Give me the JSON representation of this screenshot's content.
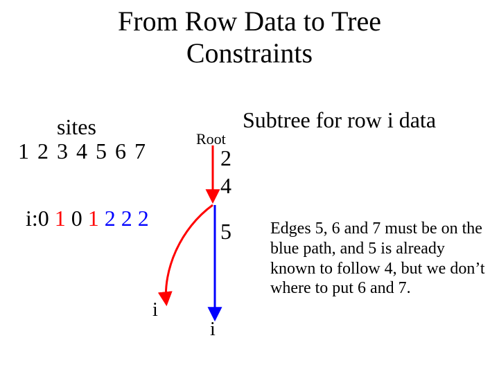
{
  "title_line1": "From Row Data to Tree",
  "title_line2": "Constraints",
  "subtree_title": "Subtree for row i data",
  "sites_label": "sites",
  "sites_numbers": "1 2 3 4 5 6 7",
  "row_i_prefix": "i:",
  "row_i_values": [
    {
      "v": "0",
      "color": "c-black"
    },
    {
      "v": "1",
      "color": "c-red"
    },
    {
      "v": "0",
      "color": "c-black"
    },
    {
      "v": "1",
      "color": "c-red"
    },
    {
      "v": "2",
      "color": "c-blue"
    },
    {
      "v": "2",
      "color": "c-blue"
    },
    {
      "v": "2",
      "color": "c-blue"
    }
  ],
  "root_label": "Root",
  "node_2": "2",
  "node_4": "4",
  "node_5": "5",
  "leaf_i_left": "i",
  "leaf_i_bottom": "i",
  "edge_note": "Edges 5, 6 and 7 must be on the blue path, and 5 is already known to follow 4, but we don’t where to put 6 and 7.",
  "colors": {
    "red": "#ff0000",
    "blue": "#0000ff",
    "black": "#000000"
  }
}
